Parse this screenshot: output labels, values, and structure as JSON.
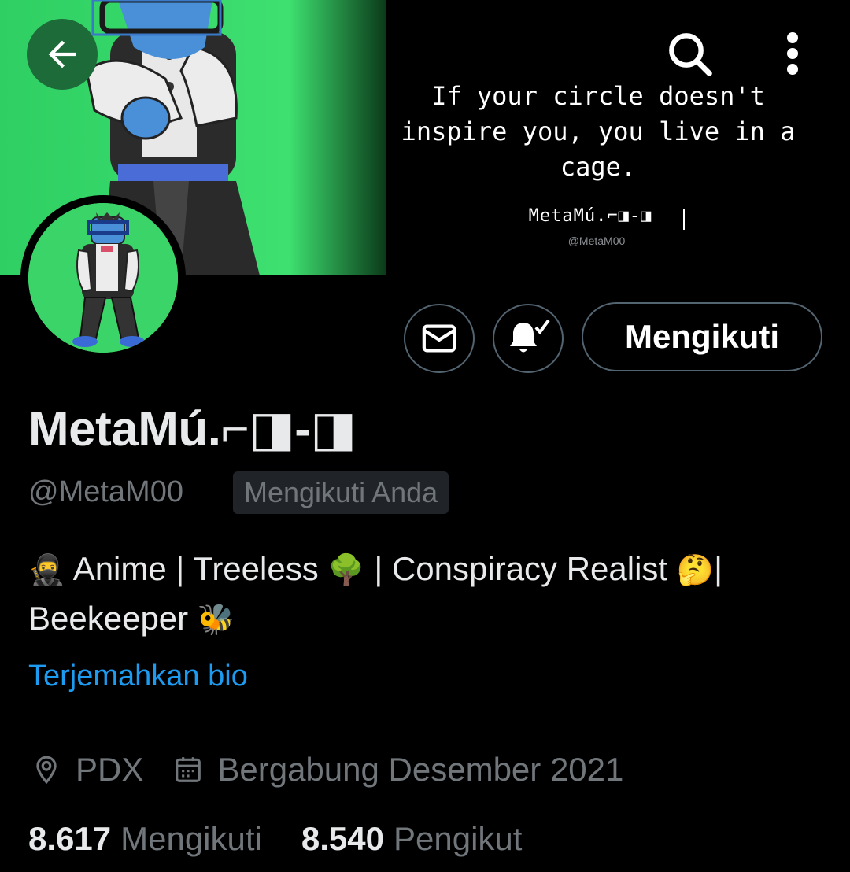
{
  "banner": {
    "quote": "If your circle doesn't\ninspire you, you live in a\ncage.",
    "signature_name": "MetaMú.⌐◨-◨",
    "signature_handle": "@MetaM00"
  },
  "nav": {
    "back_icon": "arrow-left-icon",
    "search_icon": "search-icon",
    "more_icon": "more-vertical-icon"
  },
  "profile": {
    "display_name": "MetaMú.⌐◨-◨",
    "handle": "@MetaM00",
    "follows_you_badge": "Mengikuti Anda",
    "bio_parts": {
      "p1": "Anime | Treeless",
      "p2": " |  Conspiracy Realist",
      "p3": "|",
      "p4": "Beekeeper"
    },
    "bio_emojis": {
      "ninja": "🥷",
      "tree": "🌳",
      "thinking": "🤔",
      "bee": "🐝"
    },
    "translate_label": "Terjemahkan bio",
    "location": "PDX",
    "joined": "Bergabung Desember 2021",
    "following_count": "8.617",
    "following_label": "Mengikuti",
    "followers_count": "8.540",
    "followers_label": "Pengikut"
  },
  "actions": {
    "follow_button_label": "Mengikuti",
    "message_icon": "envelope-icon",
    "notify_icon": "bell-check-icon"
  },
  "colors": {
    "accent": "#1d9bf0",
    "banner_green": "#3ad468",
    "back_button_bg": "#1c6b39",
    "muted_text": "#71767b"
  }
}
